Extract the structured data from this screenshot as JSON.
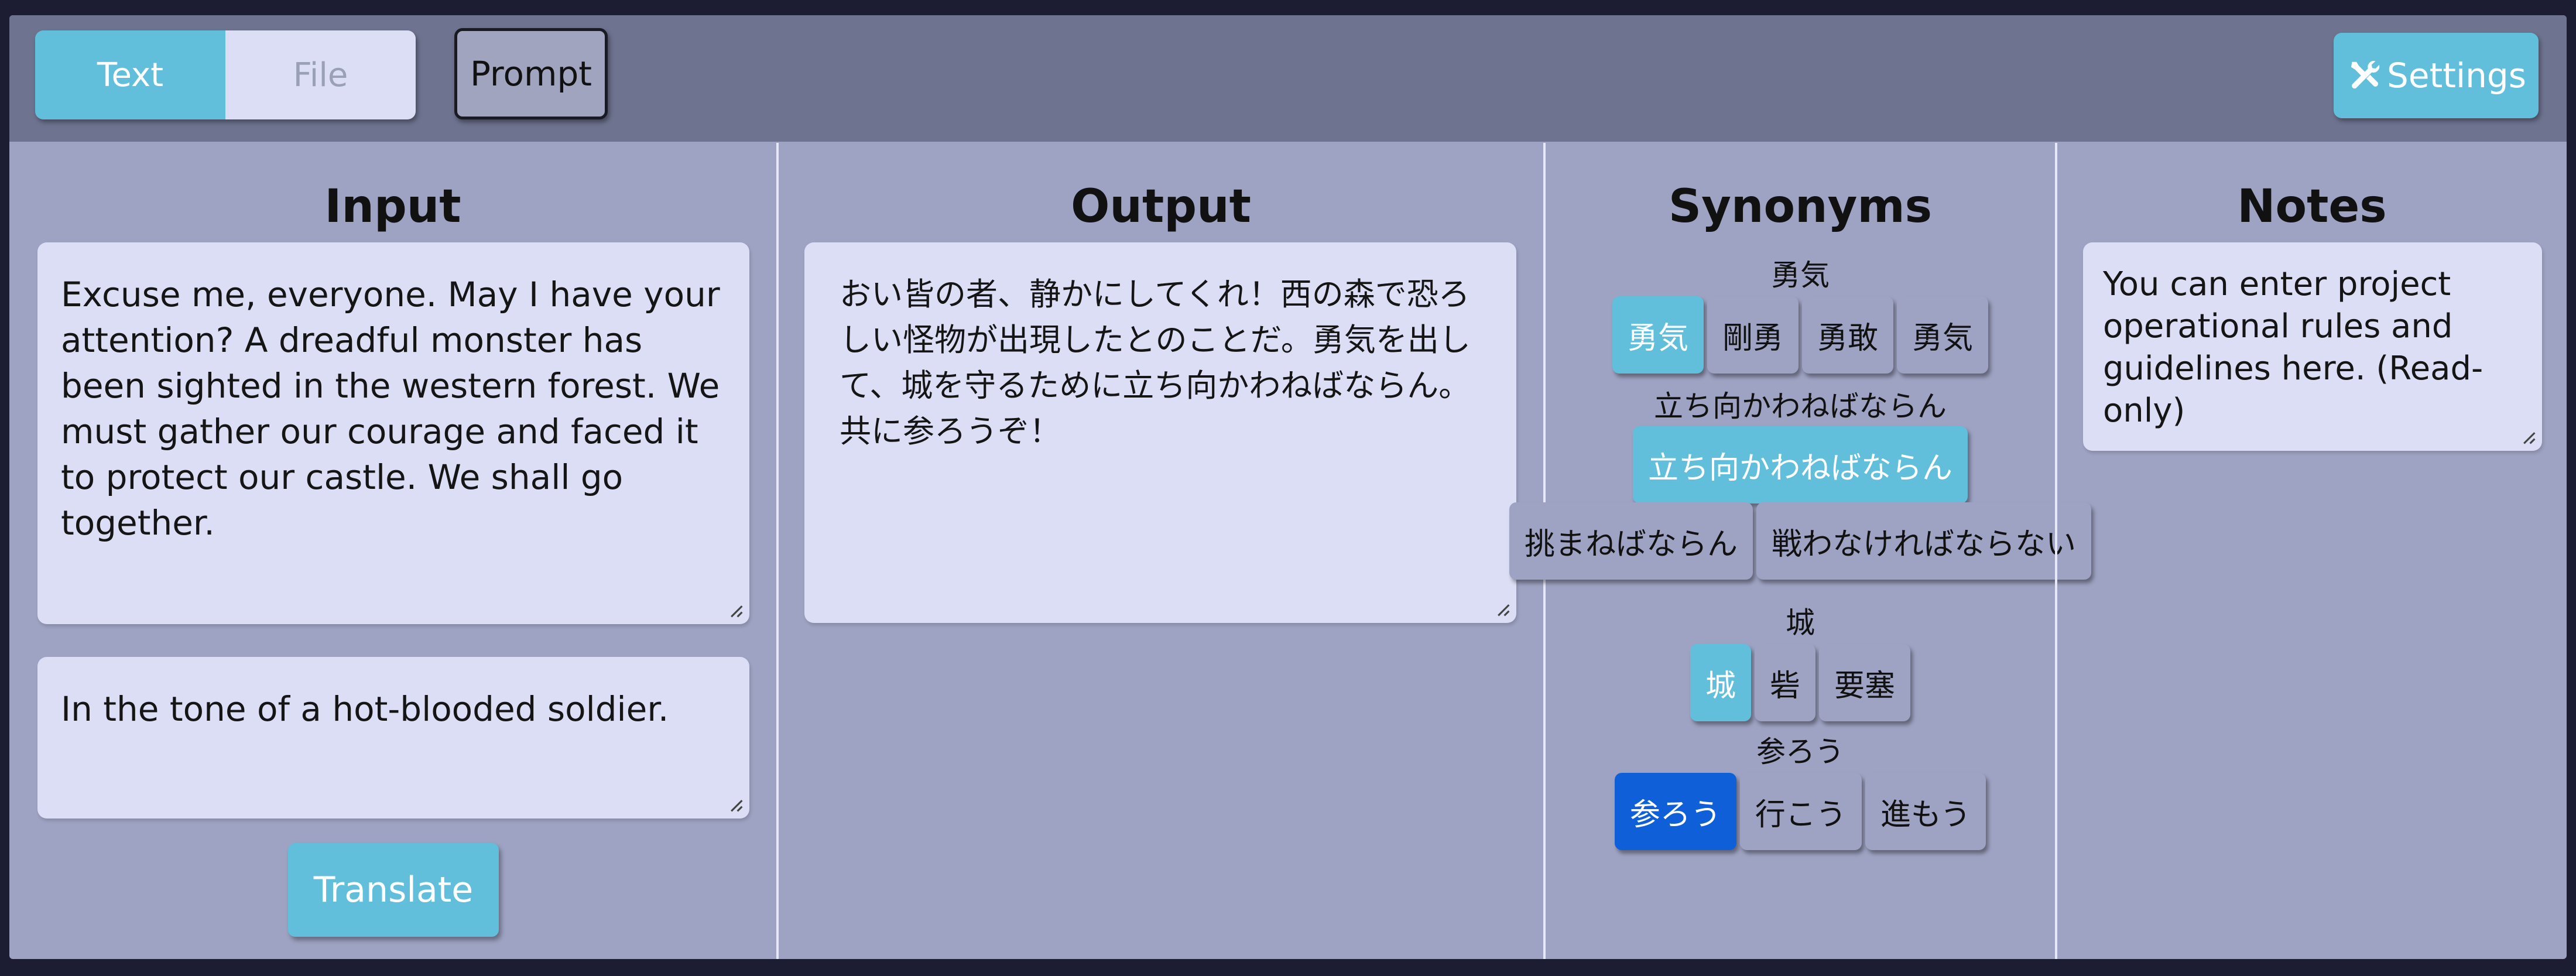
{
  "topbar": {
    "modes": [
      {
        "label": "Text",
        "active": true
      },
      {
        "label": "File",
        "active": false
      }
    ],
    "prompt_label": "Prompt",
    "settings_label": "Settings",
    "settings_icon": "tools-icon"
  },
  "input": {
    "title": "Input",
    "source_text": "Excuse me, everyone. May I have your attention? A dreadful monster has been sighted in the western forest. We must gather our courage and faced it to protect our castle. We shall go together.",
    "tone_text": "In the tone of a hot-blooded soldier.",
    "translate_label": "Translate"
  },
  "output": {
    "title": "Output",
    "text": "おい皆の者、静かにしてくれ！西の森で恐ろしい怪物が出現したとのことだ。勇気を出して、城を守るために立ち向かわねばならん。共に参ろうぞ！"
  },
  "synonyms": {
    "title": "Synonyms",
    "groups": [
      {
        "label": "勇気",
        "options": [
          "勇気",
          "剛勇",
          "勇敢",
          "勇気"
        ],
        "selected": 0
      },
      {
        "label": "立ち向かわねばならん",
        "options": [
          "立ち向かわねばならん",
          "挑まねばならん",
          "戦わなければならない"
        ],
        "selected": 0
      },
      {
        "label": "城",
        "options": [
          "城",
          "砦",
          "要塞"
        ],
        "selected": 0
      },
      {
        "label": "参ろう",
        "options": [
          "参ろう",
          "行こう",
          "進もう"
        ],
        "selected": 0
      }
    ]
  },
  "notes": {
    "title": "Notes",
    "text": "You can enter project operational rules and guidelines here. (Read-only)"
  },
  "colors": {
    "accent": "#61bfdc",
    "selected_strong": "#0f5fd8",
    "panel_bg": "#9ea3c3",
    "topbar_bg": "#6e7390",
    "field_bg": "#dcdef5"
  }
}
